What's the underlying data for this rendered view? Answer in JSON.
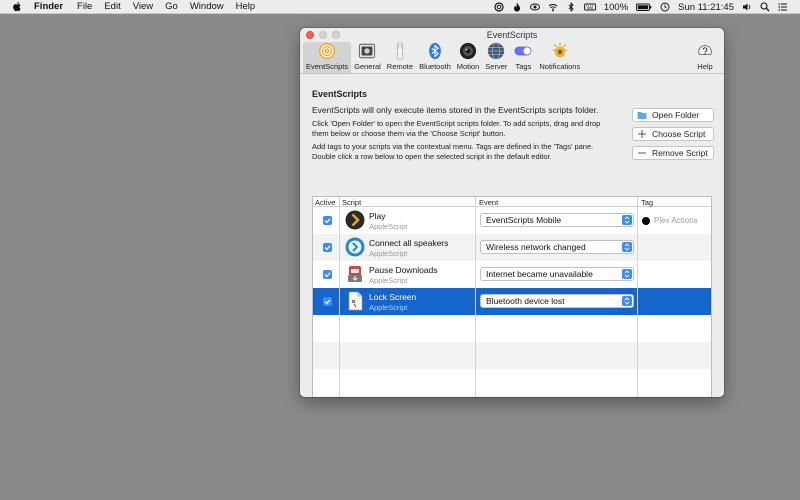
{
  "menubar": {
    "items": [
      "Finder",
      "File",
      "Edit",
      "View",
      "Go",
      "Window",
      "Help"
    ],
    "battery": "100%",
    "clock": "Sun 11:21:45"
  },
  "window": {
    "title": "EventScripts"
  },
  "toolbar": {
    "items": [
      "EventScripts",
      "General",
      "Remote",
      "Bluetooth",
      "Motion",
      "Server",
      "Tags",
      "Notifications"
    ],
    "help": "Help",
    "active": "EventScripts"
  },
  "content": {
    "section_title": "EventScripts",
    "desc1": "EventScripts will only execute items stored in the EventScripts scripts folder.",
    "desc2": "Click 'Open Folder' to open the EventScript scripts folder. To add scripts, drag and drop them below or choose them via the 'Choose Script' button.",
    "desc3": "Add tags to your scripts via the contextual menu. Tags are defined in the 'Tags' pane. Double click a row below to open the selected script in the default editor.",
    "buttons": {
      "open_folder": "Open Folder",
      "choose_script": "Choose Script",
      "remove_script": "Remove Script"
    }
  },
  "table": {
    "columns": [
      "Active",
      "Script",
      "Event",
      "Tag"
    ],
    "rows": [
      {
        "name": "Play",
        "type": "AppleScript",
        "event": "EventScripts Mobile",
        "tag": "Plex Actions",
        "active": true
      },
      {
        "name": "Connect all speakers",
        "type": "AppleScript",
        "event": "Wireless network changed",
        "tag": "",
        "active": true
      },
      {
        "name": "Pause Downloads",
        "type": "AppleScript",
        "event": "Internet became unavailable",
        "tag": "",
        "active": true
      },
      {
        "name": "Lock Screen",
        "type": "AppleScript",
        "event": "Bluetooth device lost",
        "tag": "",
        "active": true,
        "selected": true
      }
    ]
  },
  "colors": {
    "selection": "#1565cc",
    "checkbox": "#3b8cf4",
    "close_light": "#fc605b"
  }
}
